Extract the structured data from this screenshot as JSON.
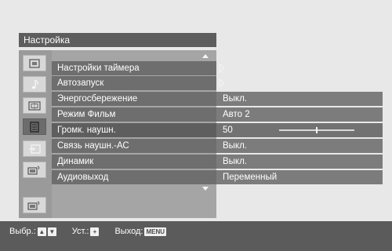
{
  "menu": {
    "title": "Настройка"
  },
  "sidebar": {
    "items": [
      {
        "icon": "picture-icon"
      },
      {
        "icon": "music-note-icon"
      },
      {
        "icon": "screen-icon"
      },
      {
        "icon": "settings-list-icon",
        "selected": true
      },
      {
        "icon": "input-icon"
      },
      {
        "icon": "pc-settings-icon"
      },
      {
        "icon": "pc-settings-alt-icon"
      }
    ]
  },
  "rows": [
    {
      "label": "Настройки таймера",
      "value": "",
      "submenu": true
    },
    {
      "label": "Автозапуск",
      "value": "",
      "submenu": true
    },
    {
      "label": "Энергосбережение",
      "value": "Выкл."
    },
    {
      "label": "Режим Фильм",
      "value": "Авто 2"
    },
    {
      "label": "Громк. наушн.",
      "value": "50",
      "slider": {
        "level": 0.5
      },
      "selected": true
    },
    {
      "label": "Связь наушн.-АС",
      "value": "Выкл."
    },
    {
      "label": "Динамик",
      "value": "Выкл."
    },
    {
      "label": "Аудиовыход",
      "value": "Переменный"
    }
  ],
  "footer": {
    "select_label": "Выбр.:",
    "select_keys": [
      "▲",
      "▼"
    ],
    "set_label": "Уст.:",
    "set_key": "+",
    "exit_label": "Выход:",
    "exit_key": "MENU"
  }
}
